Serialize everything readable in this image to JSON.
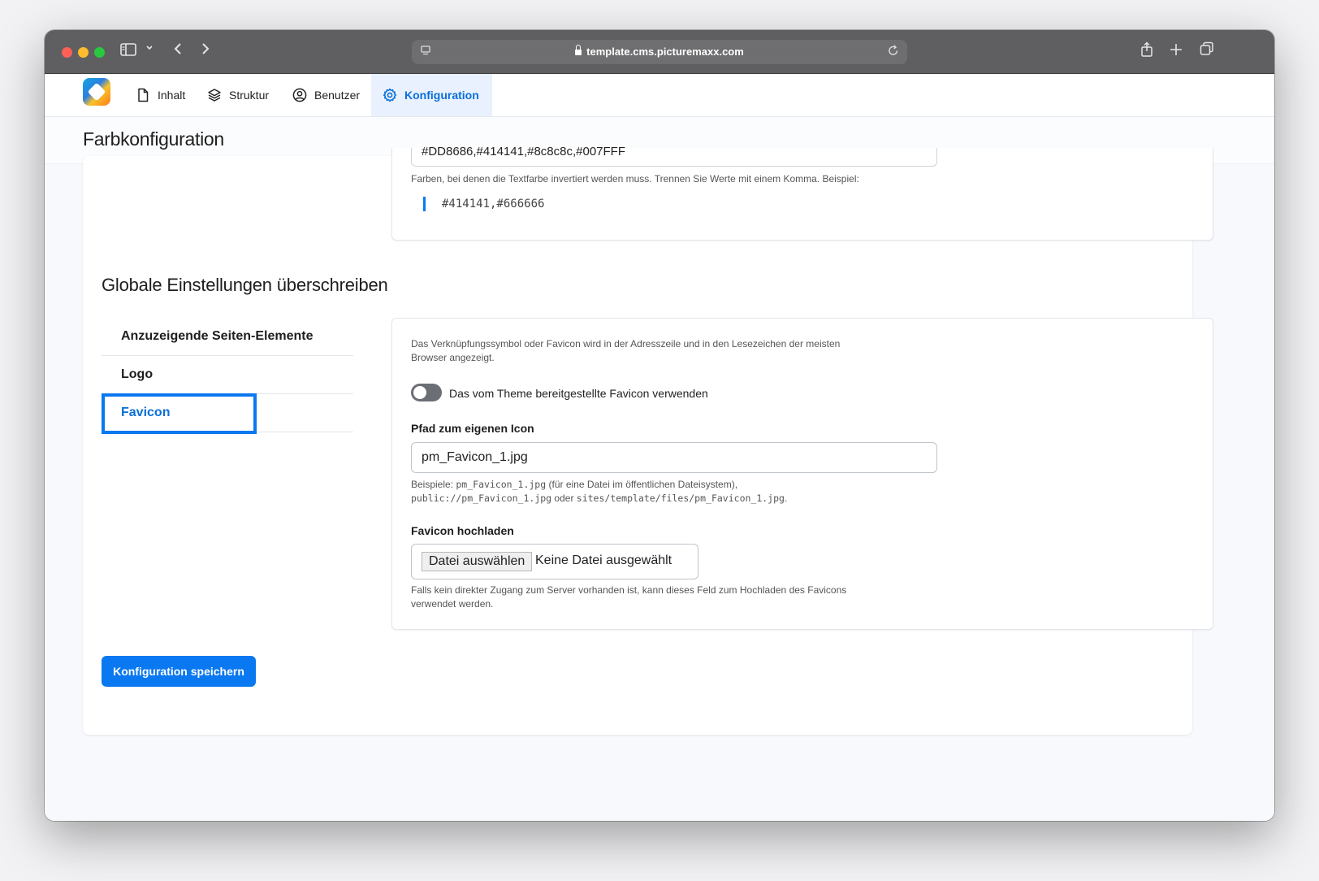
{
  "browser": {
    "url": "template.cms.picturemaxx.com"
  },
  "nav": {
    "items": [
      {
        "label": "Inhalt",
        "icon": "document-icon"
      },
      {
        "label": "Struktur",
        "icon": "layers-icon"
      },
      {
        "label": "Benutzer",
        "icon": "user-icon"
      },
      {
        "label": "Konfiguration",
        "icon": "gear-icon",
        "active": true
      }
    ]
  },
  "page": {
    "title": "Farbkonfiguration"
  },
  "color_card": {
    "inverted_colors_value": "#DD8686,#414141,#8c8c8c,#007FFF",
    "hint": "Farben, bei denen die Textfarbe invertiert werden muss. Trennen Sie Werte mit einem Komma. Beispiel:",
    "example": "#414141,#666666"
  },
  "section": {
    "title": "Globale Einstellungen überschreiben"
  },
  "tabs": [
    {
      "label": "Anzuzeigende Seiten-Elemente"
    },
    {
      "label": "Logo"
    },
    {
      "label": "Favicon",
      "active": true
    }
  ],
  "favicon": {
    "description_line1": "Das Verknüpfungssymbol oder Favicon wird in der Adresszeile und in den Lesezeichen der meisten",
    "description_line2": "Browser angezeigt.",
    "toggle_label": "Das vom Theme bereitgestellte Favicon verwenden",
    "toggle_on": false,
    "path_label": "Pfad zum eigenen Icon",
    "path_value": "pm_Favicon_1.jpg",
    "path_hint_prefix": "Beispiele: ",
    "path_hint_code1": "pm_Favicon_1.jpg",
    "path_hint_mid1": " (für eine Datei im öffentlichen Dateisystem),",
    "path_hint_code2": "public://pm_Favicon_1.jpg",
    "path_hint_mid2": " oder ",
    "path_hint_code3": "sites/template/files/pm_Favicon_1.jpg",
    "path_hint_end": ".",
    "upload_label": "Favicon hochladen",
    "upload_button": "Datei auswählen",
    "upload_status": "Keine Datei ausgewählt",
    "upload_hint_line1": "Falls kein direkter Zugang zum Server vorhanden ist, kann dieses Feld zum Hochladen des Favicons",
    "upload_hint_line2": "verwendet werden."
  },
  "actions": {
    "save_label": "Konfiguration speichern"
  },
  "colors": {
    "accent": "#0a78f0",
    "titlebar": "#5f5f61"
  }
}
